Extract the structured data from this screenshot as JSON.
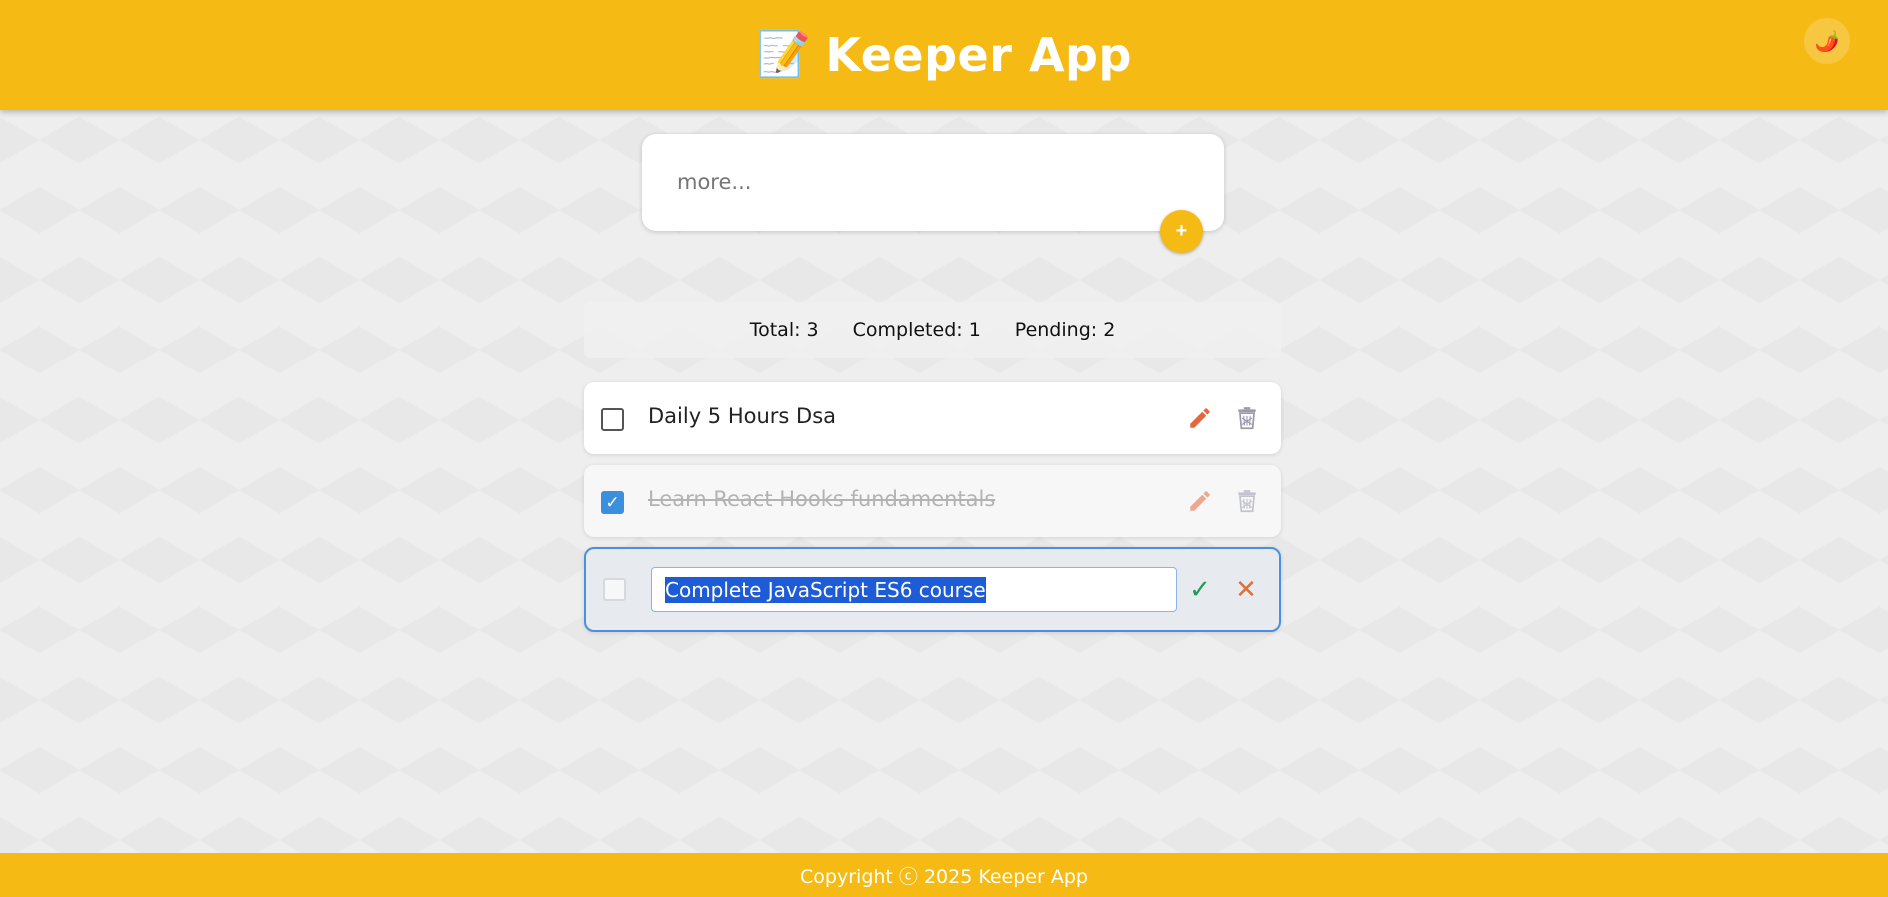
{
  "header": {
    "title": "Keeper App",
    "logo_icon": "📝",
    "theme_icon": "🌶️"
  },
  "create": {
    "placeholder": "more...",
    "add_label": "+"
  },
  "stats": {
    "total": "Total: 3",
    "completed": "Completed: 1",
    "pending": "Pending: 2"
  },
  "todos": [
    {
      "text": "Daily 5 Hours Dsa",
      "completed": false
    },
    {
      "text": "Learn React Hooks fundamentals",
      "completed": true
    },
    {
      "text": "Complete JavaScript ES6 course",
      "completed": false,
      "editing": true
    }
  ],
  "icons": {
    "check": "✓",
    "save": "✓",
    "cancel": "✕"
  },
  "colors": {
    "accent": "#f5ba13",
    "pencil": "#e8663d",
    "trash": "#9a9ab0",
    "selection": "#1e5bd6"
  },
  "footer": {
    "copyright": "Copyright ⓒ 2025 Keeper App"
  }
}
